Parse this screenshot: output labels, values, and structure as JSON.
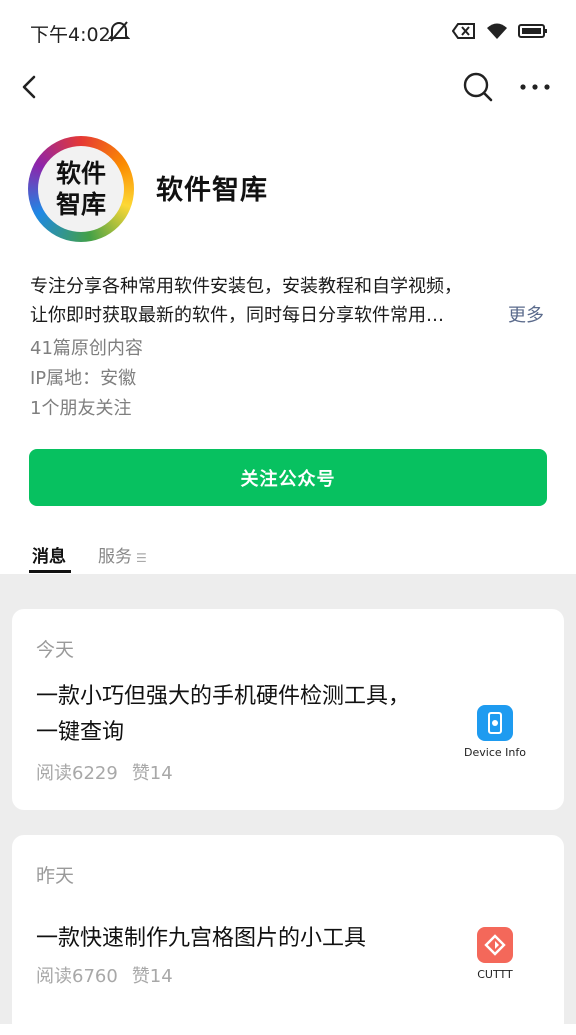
{
  "status_bar": {
    "time": "下午4:02"
  },
  "account": {
    "avatar_text": [
      "软件",
      "智库"
    ],
    "name": "软件智库",
    "description_line1": "专注分享各种常用软件安装包，安装教程和自学视频，",
    "description_line2": "让你即时获取最新的软件，同时每日分享软件常用…",
    "more_label": "更多",
    "original_count": "41篇原创内容",
    "ip_location": "IP属地：安徽",
    "friends_following": "1个朋友关注"
  },
  "follow_button": {
    "label": "关注公众号"
  },
  "tabs": [
    {
      "label": "消息",
      "active": true
    },
    {
      "label": "服务",
      "active": false
    }
  ],
  "articles": [
    {
      "day": "今天",
      "title_line1": "一款小巧但强大的手机硬件检测工具，",
      "title_line2": "一键查询",
      "reads": "阅读6229",
      "likes": "赞14",
      "thumb_caption": "Device Info",
      "thumb_color": "#1e9bf0"
    },
    {
      "day": "昨天",
      "title_line1": "一款快速制作九宫格图片的小工具",
      "reads": "阅读6760",
      "likes": "赞14",
      "thumb_caption": "CUTTT",
      "thumb_color": "#f4685a"
    }
  ],
  "colors": {
    "accent_green": "#07c160",
    "link_blue": "#5b6b8c",
    "feed_bg": "#ededed"
  }
}
